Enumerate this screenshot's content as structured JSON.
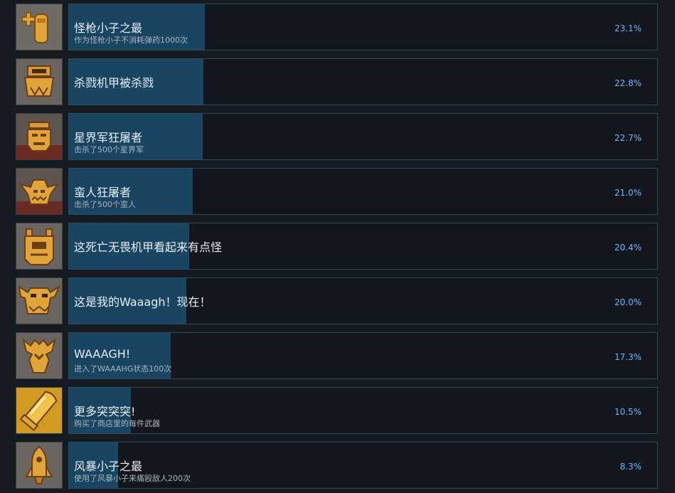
{
  "achievements": [
    {
      "title": "怪枪小子之最",
      "description": "作为怪枪小子不消耗弹药1000次",
      "percent": "23.1%",
      "percent_value": 23.1,
      "icon": "ammo-pack-icon"
    },
    {
      "title": "杀戮机甲被杀戮",
      "description": "",
      "percent": "22.8%",
      "percent_value": 22.8,
      "icon": "killa-kan-icon"
    },
    {
      "title": "星界军狂屠者",
      "description": "击杀了500个星界军",
      "percent": "22.7%",
      "percent_value": 22.7,
      "icon": "guardsman-head-icon"
    },
    {
      "title": "蛮人狂屠者",
      "description": "击杀了500个蛮人",
      "percent": "21.0%",
      "percent_value": 21.0,
      "icon": "ork-head-icon"
    },
    {
      "title": "这死亡无畏机甲看起来有点怪",
      "description": "",
      "percent": "20.4%",
      "percent_value": 20.4,
      "icon": "deff-dread-icon"
    },
    {
      "title": "这是我的Waaagh！现在！",
      "description": "",
      "percent": "20.0%",
      "percent_value": 20.0,
      "icon": "horned-helmet-icon"
    },
    {
      "title": "WAAAGH!",
      "description": "进入了WAAAHG状态100次",
      "percent": "17.3%",
      "percent_value": 17.3,
      "icon": "ork-glyph-icon"
    },
    {
      "title": "更多突突突!",
      "description": "购买了商店里的每件武器",
      "percent": "10.5%",
      "percent_value": 10.5,
      "icon": "bullet-icon"
    },
    {
      "title": "风暴小子之最",
      "description": "使用了风暴小子来痛殴敌人200次",
      "percent": "8.3%",
      "percent_value": 8.3,
      "icon": "stormboy-rocket-icon"
    }
  ]
}
